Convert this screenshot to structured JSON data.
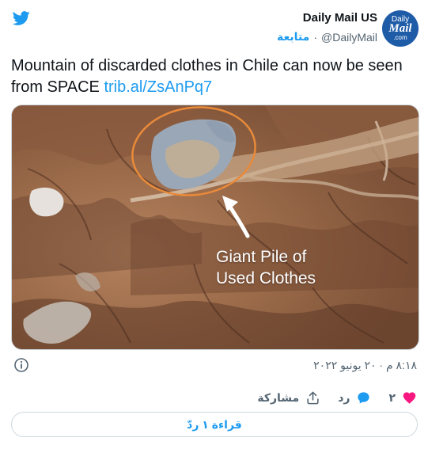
{
  "author": {
    "name": "Daily Mail US",
    "handle": "@DailyMail",
    "follow_label": "متابعة",
    "separator": "·",
    "avatar": {
      "line1": "Daily",
      "line2": "Mail",
      "line3": ".com"
    }
  },
  "tweet": {
    "text": "Mountain of discarded clothes in Chile can now be seen from SPACE",
    "link": "trib.al/ZsAnPq7",
    "image_caption_line1": "Giant Pile of",
    "image_caption_line2": "Used Clothes"
  },
  "timestamp": "٨:١٨ م · ٢٠ يونيو ٢٠٢٢",
  "actions": {
    "like_count": "٢",
    "reply_label": "رد",
    "share_label": "مشاركة"
  },
  "read_replies_label": "قراءة ١ ردّ",
  "colors": {
    "accent": "#1d9bf0",
    "like": "#f91880",
    "brand": "#1f5ca8",
    "annotation_ring": "#e88a3a"
  },
  "icons": [
    "twitter-bird-icon",
    "info-icon",
    "heart-icon",
    "reply-bubble-icon",
    "share-icon"
  ]
}
